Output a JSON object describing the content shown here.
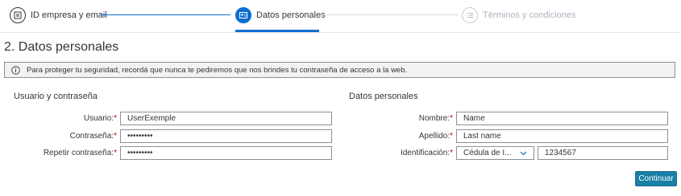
{
  "wizard": {
    "steps": [
      {
        "label": "ID empresa y email",
        "icon": "card-id-icon",
        "state": "completed"
      },
      {
        "label": "Datos personales",
        "icon": "person-card-icon",
        "state": "active"
      },
      {
        "label": "Términos y condiciones",
        "icon": "checklist-icon",
        "state": "upcoming"
      }
    ]
  },
  "page": {
    "title": "2. Datos personales",
    "info_message": "Para proteger tu seguridad, recordá que nunca te pediremos que nos brindes tu contraseña de acceso a la web."
  },
  "left_group": {
    "title": "Usuario y contraseña",
    "usuario": {
      "label": "Usuario:",
      "value": "UserExemple"
    },
    "contrasena": {
      "label": "Contraseña:",
      "value": "•••••••••"
    },
    "repetir": {
      "label": "Repetir contraseña:",
      "value": "•••••••••"
    }
  },
  "right_group": {
    "title": "Datos personales",
    "nombre": {
      "label": "Nombre:",
      "value": "Name"
    },
    "apellido": {
      "label": "Apellido:",
      "value": "Last name"
    },
    "identificacion": {
      "label": "Identificación:",
      "type_value": "Cédula de I...",
      "number_value": "1234567"
    }
  },
  "required_mark": "*",
  "actions": {
    "continue_label": "Continuar"
  },
  "colors": {
    "accent": "#0a6ed1",
    "required": "#bb0000",
    "button": "#1a7fa6"
  }
}
